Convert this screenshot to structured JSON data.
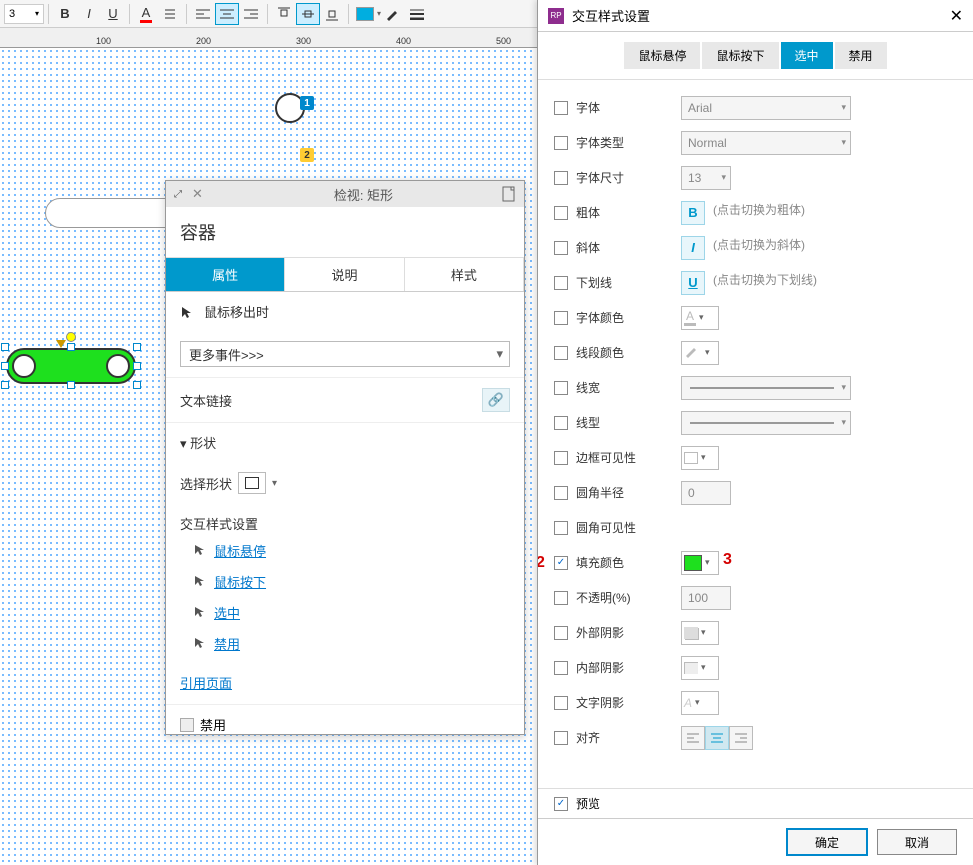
{
  "toolbar": {
    "font_size": "3",
    "bold": "B",
    "italic": "I",
    "underline": "U",
    "fill_color": "#009ad8",
    "fill2_color": "#00aee0"
  },
  "ruler": {
    "ticks": [
      "100",
      "200",
      "300",
      "400",
      "500"
    ]
  },
  "markers": {
    "one": "1",
    "two": "2"
  },
  "inspector": {
    "header": "检视: 矩形",
    "name": "容器",
    "tabs": {
      "props": "属性",
      "notes": "说明",
      "style": "样式"
    },
    "mouse_out": "鼠标移出时",
    "more_events": "更多事件>>>",
    "text_link": "文本链接",
    "shape_section": "▾  形状",
    "select_shape": "选择形状",
    "interaction_styles": "交互样式设置",
    "hover": "鼠标悬停",
    "mousedown": "鼠标按下",
    "selected": "选中",
    "disabled": "禁用",
    "ref_page": "引用页面",
    "disable2": "禁用"
  },
  "annotations": {
    "a1": "1",
    "a2": "2",
    "a3": "3"
  },
  "dialog": {
    "title": "交互样式设置",
    "tabs": {
      "hover": "鼠标悬停",
      "mousedown": "鼠标按下",
      "selected": "选中",
      "disabled": "禁用"
    },
    "props": {
      "font": "字体",
      "font_val": "Arial",
      "font_type": "字体类型",
      "font_type_val": "Normal",
      "font_size": "字体尺寸",
      "font_size_val": "13",
      "bold": "粗体",
      "bold_hint": "(点击切换为粗体)",
      "italic": "斜体",
      "italic_hint": "(点击切换为斜体)",
      "underline": "下划线",
      "underline_hint": "(点击切换为下划线)",
      "text_color": "字体颜色",
      "line_color": "线段颜色",
      "line_width": "线宽",
      "line_style": "线型",
      "border_vis": "边框可见性",
      "corner_radius": "圆角半径",
      "corner_radius_val": "0",
      "corner_vis": "圆角可见性",
      "fill_color": "填充颜色",
      "opacity": "不透明(%)",
      "opacity_val": "100",
      "outer_shadow": "外部阴影",
      "inner_shadow": "内部阴影",
      "text_shadow": "文字阴影",
      "align": "对齐"
    },
    "preview": "预览",
    "ok": "确定",
    "cancel": "取消"
  }
}
